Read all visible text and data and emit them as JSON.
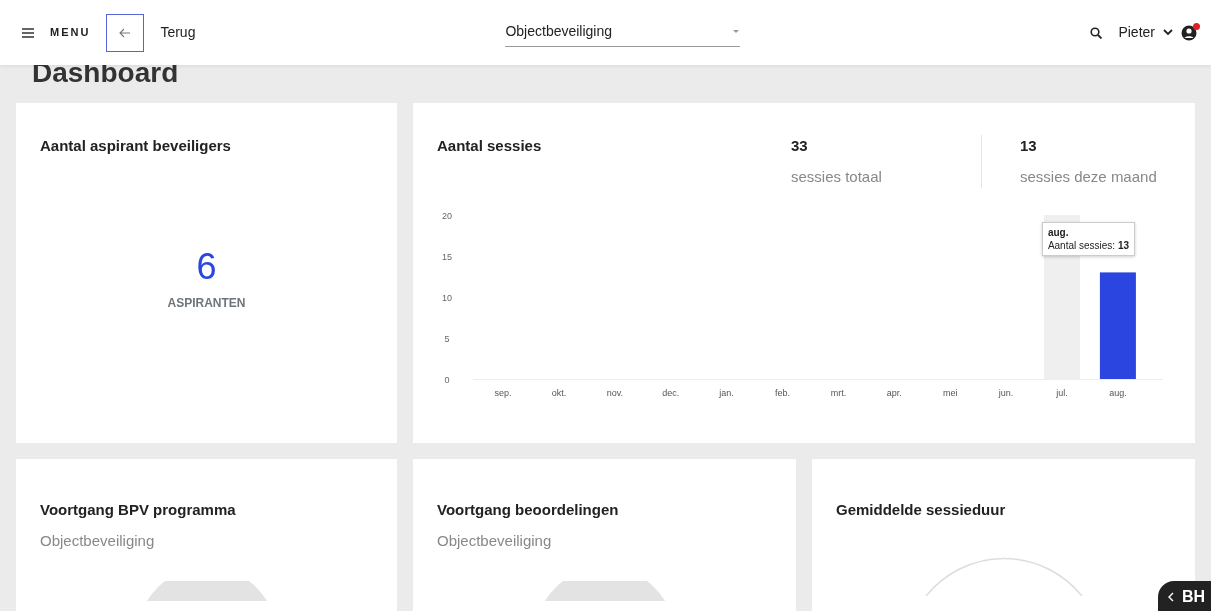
{
  "header": {
    "menu_label": "MENU",
    "back_label": "Terug",
    "program_select": {
      "value": "Objectbeveiliging"
    },
    "user_name": "Pieter",
    "notification_dot": true
  },
  "page_title": "Dashboard",
  "aspirants_card": {
    "title": "Aantal aspirant beveiligers",
    "count": "6",
    "unit": "ASPIRANTEN"
  },
  "sessions_card": {
    "title": "Aantal sessies",
    "stats": [
      {
        "value": "33",
        "label": "sessies totaal"
      },
      {
        "value": "13",
        "label": "sessies deze maand"
      }
    ],
    "chart_data": {
      "type": "bar",
      "categories": [
        "sep.",
        "okt.",
        "nov.",
        "dec.",
        "jan.",
        "feb.",
        "mrt.",
        "apr.",
        "mei",
        "jun.",
        "jul.",
        "aug."
      ],
      "series": [
        {
          "color": "#2a45e0",
          "values": [
            0,
            0,
            0,
            0,
            0,
            0,
            0,
            0,
            0,
            0,
            0,
            13
          ]
        }
      ],
      "ylim": [
        0,
        20
      ],
      "yticks": [
        0,
        5,
        10,
        15,
        20
      ]
    },
    "tooltip": {
      "title": "aug.",
      "text": "Aantal sessies: **13**"
    }
  },
  "bottom_cards": [
    {
      "title": "Voortgang BPV programma",
      "subtitle": "Objectbeveiliging",
      "kind": "donut"
    },
    {
      "title": "Voortgang beoordelingen",
      "subtitle": "Objectbeveiliging",
      "kind": "donut"
    },
    {
      "title": "Gemiddelde sessieduur",
      "kind": "ring"
    }
  ],
  "chat_widget": {
    "label": "BH"
  }
}
